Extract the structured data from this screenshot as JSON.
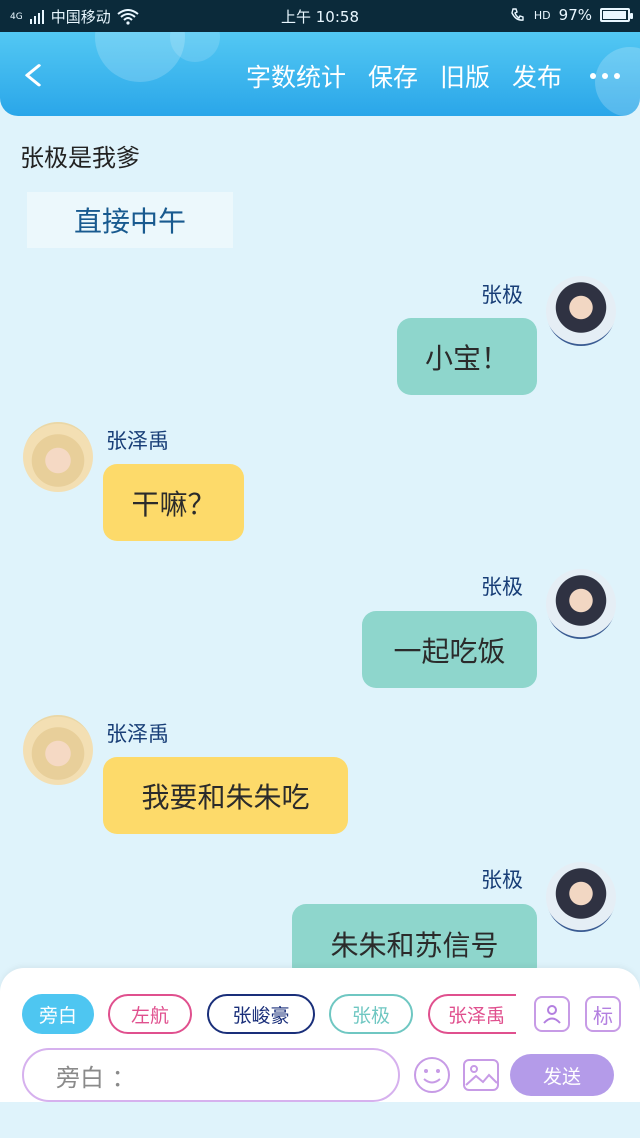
{
  "status_bar": {
    "network": "4G",
    "carrier": "中国移动",
    "time": "上午 10:58",
    "hd": "HD",
    "battery": "97%",
    "battery_level": 0.97
  },
  "header": {
    "actions": [
      "字数统计",
      "保存",
      "旧版",
      "发布"
    ]
  },
  "story": {
    "title": "张极是我爹",
    "note": "直接中午"
  },
  "messages": [
    {
      "side": "right",
      "name": "张极",
      "text": "小宝！"
    },
    {
      "side": "left",
      "name": "张泽禹",
      "text": "干嘛？"
    },
    {
      "side": "right",
      "name": "张极",
      "text": "一起吃饭"
    },
    {
      "side": "left",
      "name": "张泽禹",
      "text": "我要和朱朱吃"
    },
    {
      "side": "right",
      "name": "张极",
      "text": "朱朱和苏信号"
    }
  ],
  "composer": {
    "chips": [
      {
        "label": "旁白",
        "color": "#4ec6f1",
        "active": true
      },
      {
        "label": "左航",
        "color": "#e0508e",
        "active": false
      },
      {
        "label": "张峻豪",
        "color": "#1a2f7a",
        "active": false
      },
      {
        "label": "张极",
        "color": "#6fc7c2",
        "active": false
      },
      {
        "label": "张泽禹",
        "color": "#e0508e",
        "active": false
      }
    ],
    "tag_label": "标",
    "input_value": "旁白 ：",
    "send_label": "发送"
  }
}
